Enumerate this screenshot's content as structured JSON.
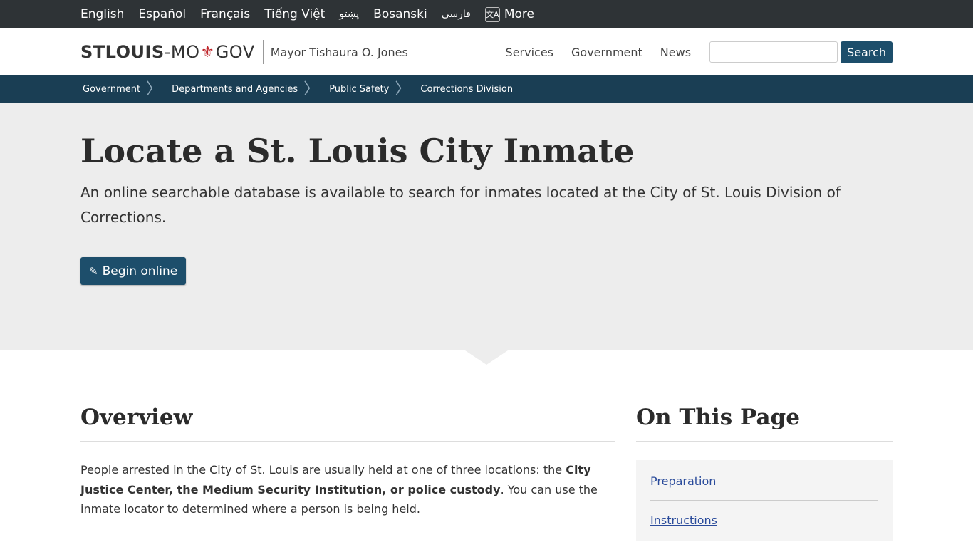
{
  "languages": [
    "English",
    "Español",
    "Français",
    "Tiếng Việt",
    "پښتو",
    "Bosanski",
    "فارسی"
  ],
  "lang_more_label": "More",
  "header": {
    "logo_part1": "STLOUIS",
    "logo_dash": "-MO",
    "logo_part2": "GOV",
    "mayor": "Mayor Tishaura O. Jones",
    "nav": [
      "Services",
      "Government",
      "News"
    ],
    "search_button": "Search",
    "search_value": ""
  },
  "breadcrumb": [
    "Government",
    "Departments and Agencies",
    "Public Safety",
    "Corrections Division"
  ],
  "hero": {
    "title": "Locate a St. Louis City Inmate",
    "description": "An online searchable database is available to search for inmates located at the City of St. Louis Division of Corrections.",
    "button_label": "Begin online"
  },
  "overview": {
    "heading": "Overview",
    "text_before": "People arrested in the City of St. Louis are usually held at one of three locations: the ",
    "text_bold": "City Justice Center, the Medium Security Institution, or police custody",
    "text_after": ". You can use the inmate locator to determined where a person is being held."
  },
  "on_this_page": {
    "heading": "On This Page",
    "links": [
      "Preparation",
      "Instructions"
    ]
  },
  "colors": {
    "accent": "#1d4e6b",
    "breadcrumb_bg": "#1a3e54",
    "lang_bar_bg": "#2e3336",
    "hero_bg": "#ededed",
    "logo_fleur": "#c0282d"
  }
}
